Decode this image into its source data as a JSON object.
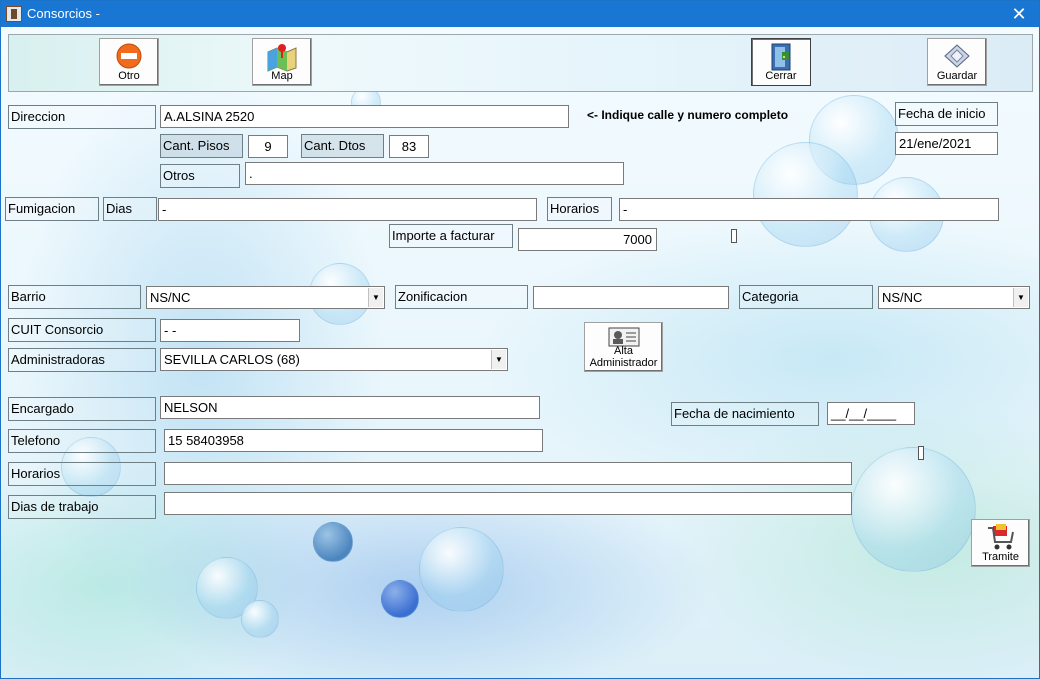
{
  "window": {
    "title": "Consorcios -",
    "close_glyph": "✕"
  },
  "toolbar": {
    "otro": "Otro",
    "map": "Map",
    "cerrar": "Cerrar",
    "guardar": "Guardar"
  },
  "form": {
    "direccion": {
      "label": "Direccion",
      "value": "A.ALSINA 2520",
      "hint": "<- Indique calle y numero completo"
    },
    "fecha_inicio": {
      "label": "Fecha de inicio",
      "value": "21/ene/2021"
    },
    "cant_pisos": {
      "label": "Cant. Pisos",
      "value": "9"
    },
    "cant_dtos": {
      "label": "Cant. Dtos",
      "value": "83"
    },
    "otros": {
      "label": "Otros",
      "value": "."
    },
    "fumigacion": {
      "label": "Fumigacion"
    },
    "dias": {
      "label": "Dias",
      "value": "-"
    },
    "horarios_fum": {
      "label": "Horarios",
      "value": "-"
    },
    "importe": {
      "label": "Importe a facturar",
      "value": "7000"
    },
    "barrio": {
      "label": "Barrio",
      "value": "NS/NC"
    },
    "zonificacion": {
      "label": "Zonificacion",
      "value": ""
    },
    "categoria": {
      "label": "Categoria",
      "value": "NS/NC"
    },
    "cuit": {
      "label": "CUIT Consorcio",
      "value": "-       -"
    },
    "administradoras": {
      "label": "Administradoras",
      "value": "SEVILLA CARLOS (68)"
    },
    "alta_admin": {
      "label_line1": "Alta",
      "label_line2": "Administrador"
    },
    "encargado": {
      "label": "Encargado",
      "value": "NELSON"
    },
    "fecha_nac": {
      "label": "Fecha de nacimiento",
      "value": "__/__/____"
    },
    "telefono": {
      "label": "Telefono",
      "value": "15 58403958"
    },
    "horarios": {
      "label": "Horarios",
      "value": ""
    },
    "dias_trabajo": {
      "label": "Dias de trabajo",
      "value": ""
    }
  },
  "tramite": {
    "label": "Tramite"
  },
  "dropdown_glyph": "▼"
}
